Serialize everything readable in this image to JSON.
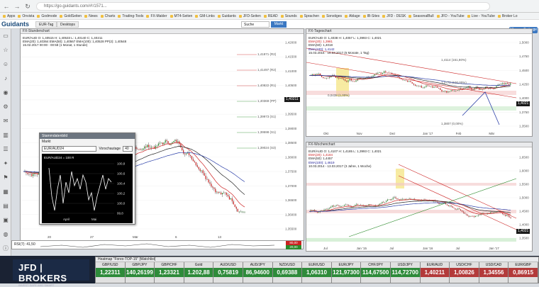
{
  "browser": {
    "url": "https://go.guidants.com/#!/1571...",
    "bookmarks": [
      "Apps",
      "Onvista",
      "Godmode",
      "GoldSeiten",
      "News",
      "Charts",
      "Trading-Tools",
      "FX-Makler",
      "MT4-Seiten",
      "GM-Links",
      "Guidants",
      "JFD-Seiten",
      "READ",
      "Sounds",
      "Sprachen",
      "Sonstiges",
      "Ablage",
      "IB-Sites",
      "JFD - DESK",
      "SeasonalBull",
      "JFD - YouTube",
      "Live - YouTube",
      "Broker Lo"
    ]
  },
  "app": {
    "logo": "Guidants",
    "tabs": [
      "EUR-Tag",
      "Desktops"
    ],
    "search_label": "Suche",
    "market_label": "Markt",
    "news_badge": "16 neue Beitrage"
  },
  "sidebar_icons": [
    "monitor-icon",
    "star-icon",
    "user-icon",
    "bell-icon",
    "eye-icon",
    "gear-icon",
    "message-icon",
    "chart-icon",
    "list-icon",
    "bulb-icon",
    "flag-icon",
    "calendar-icon",
    "doc-icon",
    "grid-icon",
    "globe-icon",
    "info-icon"
  ],
  "hourly_chart": {
    "title": "FX-Stundenchart",
    "legend": [
      {
        "text": "EUR/AUD O: 1,40515  H: 1,40533  L: 1,40140  C: 1,40211",
        "cls": ""
      },
      {
        "text": "EMA(20): 1,40364   EMA(50): 1,40567   EMA(100): 1,40528   PP(2): 1,40548",
        "cls": ""
      },
      {
        "text": "15.02.2017 00:00 - 00:58  (1 Monat, 1 Stunde)",
        "cls": ""
      }
    ],
    "levels": [
      "1,41871 (R2)",
      "1,41497 (R2)",
      "1,40822 (R1)",
      "1,40369 (PP)",
      "1,39973 (S1)",
      "1,39598 (S1)",
      "1,39024 (S3)"
    ],
    "yticks": [
      "1,42000",
      "1,41500",
      "1,41000",
      "1,40500",
      "1,40000",
      "1,39500",
      "1,39000",
      "1,38500",
      "1,38000",
      "1,37500",
      "1,37000",
      "1,36500",
      "1,36000",
      "1,35500"
    ],
    "xticks": [
      "20",
      "27",
      "Mär",
      "6",
      "13"
    ],
    "price_tag": "1,40211"
  },
  "daily_chart": {
    "title": "FX-Tageschart",
    "legend": [
      {
        "text": "EUR/AUD O: 1,4038  H: 1,4057  L: 1,3993  C: 1,4021",
        "cls": ""
      },
      {
        "text": "EMA(20): 1,3981",
        "cls": "red"
      },
      {
        "text": "EMA(50): 1,4018",
        "cls": ""
      },
      {
        "text": "EMA(100): 1,4142",
        "cls": "blue"
      },
      {
        "text": "15.03.2016 - 15.03.2017 (6 Monate, 1 Tag)",
        "cls": ""
      }
    ],
    "fibs": [
      "1,4114 (161,80%)",
      "1,3772 (100,00%)",
      "0,0438 (1,00%)",
      "1,3807 (0,00%)"
    ],
    "yticks": [
      "1,5000",
      "1,4750",
      "1,4500",
      "1,4250",
      "1,4000",
      "1,3750",
      "1,3500"
    ],
    "xticks": [
      "Okt",
      "Nov",
      "Dez",
      "Jan '17",
      "Feb",
      "Mär"
    ],
    "price_tag": "1,4021"
  },
  "weekly_chart": {
    "title": "FX-Wochenchart",
    "legend": [
      {
        "text": "EUR/AUD O: 1,4107  H: 1,4185  L: 1,3993  C: 1,4021",
        "cls": ""
      },
      {
        "text": "EMA(20): 1,4184",
        "cls": "red"
      },
      {
        "text": "EMA(50): 1,4457",
        "cls": ""
      },
      {
        "text": "EMA(100): 1,4619",
        "cls": "blue"
      },
      {
        "text": "10.03.2014 - 13.03.2017 (3 Jahre, 1 Woche)",
        "cls": ""
      }
    ],
    "yticks": [
      "1,6500",
      "1,6000",
      "1,5500",
      "1,5000",
      "1,4500",
      "1,4000",
      "1,3500"
    ],
    "xticks": [
      "Jul",
      "Jan '15",
      "Jul",
      "Jan '16",
      "Jul",
      "Jan '17"
    ],
    "price_tag": "1,4021"
  },
  "float_window": {
    "title": "Stammdatenbild",
    "subtitle": "Markt",
    "symbol": "EUR/AUD24",
    "period_label": "Vorschautage",
    "period_value": "40",
    "mini_label": "EUR/AUD24 = 100 R",
    "mini_yticks": [
      "100,8",
      "100,6",
      "100,4",
      "100,2",
      "100,0",
      "99,8"
    ],
    "mini_xticks": [
      "April",
      "Mai"
    ]
  },
  "rsi": {
    "label": "RSI(7): 41,50",
    "tag1": "80,00",
    "tag2": "20,00"
  },
  "brand": {
    "name": "JFD | BROKERS",
    "tagline": "INVEST SAFE AND SMART"
  },
  "heatmap": {
    "title": "Heatmap \"Forex-TOP-15\" [Watchlist]",
    "cells": [
      {
        "pair": "GBP/USD",
        "price": "1,22311",
        "pct": "",
        "color": "#2e8b3a"
      },
      {
        "pair": "GBP/JPY",
        "price": "140,26199",
        "pct": "",
        "color": "#2e8b3a"
      },
      {
        "pair": "GBP/CHF",
        "price": "1,23321",
        "pct": "",
        "color": "#2e8b3a"
      },
      {
        "pair": "Gold",
        "price": "1.202,88",
        "pct": "",
        "color": "#2e8b3a"
      },
      {
        "pair": "AUD/USD",
        "price": "0,75819",
        "pct": "",
        "color": "#2e8b3a"
      },
      {
        "pair": "AUD/JPY",
        "price": "86,94600",
        "pct": "",
        "color": "#2e8b3a"
      },
      {
        "pair": "NZD/USD",
        "price": "0,69388",
        "pct": "",
        "color": "#2e8b3a"
      },
      {
        "pair": "EUR/USD",
        "price": "1,06310",
        "pct": "",
        "color": "#2e8b3a"
      },
      {
        "pair": "EUR/JPY",
        "price": "121,97300",
        "pct": "",
        "color": "#2e8b3a"
      },
      {
        "pair": "CHF/JPY",
        "price": "114,67500",
        "pct": "",
        "color": "#2e8b3a"
      },
      {
        "pair": "USD/JPY",
        "price": "114,72700",
        "pct": "",
        "color": "#2e8b3a"
      },
      {
        "pair": "EUR/AUD",
        "price": "1,40211",
        "pct": "",
        "color": "#b33a3a"
      },
      {
        "pair": "USD/CHF",
        "price": "1,00826",
        "pct": "",
        "color": "#b33a3a"
      },
      {
        "pair": "USD/CAD",
        "price": "1,34556",
        "pct": "",
        "color": "#b33a3a"
      },
      {
        "pair": "EUR/GBP",
        "price": "0,86915",
        "pct": "",
        "color": "#b33a3a"
      }
    ]
  }
}
